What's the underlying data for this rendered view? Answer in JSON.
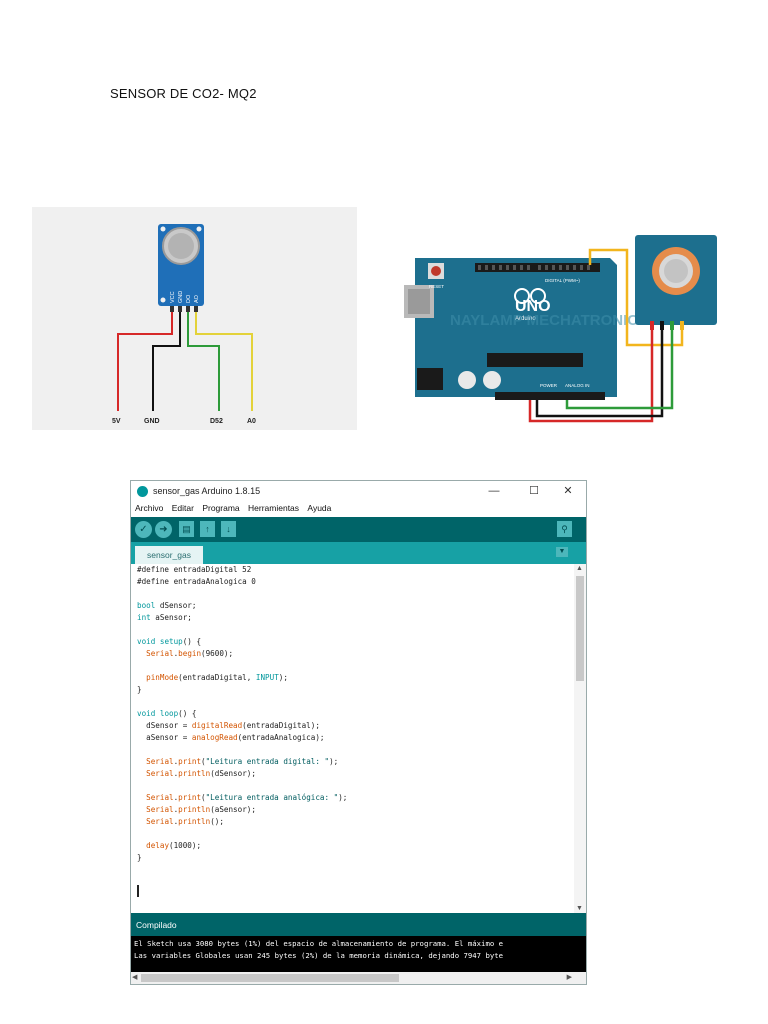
{
  "page": {
    "title": "SENSOR DE CO2- MQ2"
  },
  "figure1": {
    "pins": [
      "VCC",
      "GND",
      "DO",
      "AO"
    ],
    "labels": {
      "vcc": "5V",
      "gnd": "GND",
      "do": "D52",
      "ao": "A0"
    },
    "wire_colors": {
      "vcc": "#d62828",
      "gnd": "#111111",
      "do": "#2e9b3a",
      "ao": "#e3d23a"
    }
  },
  "figure2": {
    "board_text": "UNO",
    "board_brand": "Arduino",
    "watermark": "NAYLAMP MECHATRONICS",
    "reset_label": "RESET",
    "digital_label": "DIGITAL (PWM~)",
    "power_label": "POWER",
    "analog_label": "ANALOG IN",
    "wire_colors": {
      "red": "#d62828",
      "black": "#111111",
      "green": "#2e9b3a",
      "yellow": "#f2b51d"
    },
    "board_color": "#1d6f8e"
  },
  "ide": {
    "window_title": "sensor_gas Arduino 1.8.15",
    "window_buttons": {
      "minimize": "—",
      "maximize": "☐",
      "close": "✕"
    },
    "menu": [
      "Archivo",
      "Editar",
      "Programa",
      "Herramientas",
      "Ayuda"
    ],
    "toolbar_icons": [
      "verify-icon",
      "upload-icon",
      "new-icon",
      "open-icon",
      "save-icon",
      "serial-monitor-icon"
    ],
    "tab_label": "sensor_gas",
    "status_text": "Compilado",
    "console_lines": [
      "El Sketch usa 3080 bytes (1%) del espacio de almacenamiento de programa. El máximo e",
      "Las variables Globales usan 245 bytes (2%) de la memoria dinámica, dejando 7947 byte"
    ],
    "accent_colors": {
      "toolbar": "#006468",
      "tabbar": "#17a1a5",
      "keyword": "#00979c",
      "function": "#d35400"
    }
  }
}
